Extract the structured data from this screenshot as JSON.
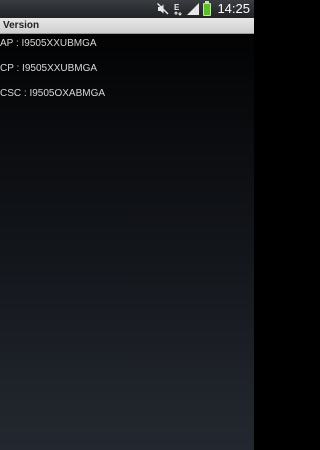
{
  "status_bar": {
    "time": "14:25",
    "icons": [
      "mute-icon",
      "network-e-icon",
      "signal-icon",
      "battery-icon"
    ],
    "battery_color": "#5bbd2a"
  },
  "title_bar": {
    "title": "Version"
  },
  "versions": [
    {
      "text": "AP : I9505XXUBMGA"
    },
    {
      "text": "CP : I9505XXUBMGA"
    },
    {
      "text": "CSC : I9505OXABMGA"
    }
  ]
}
